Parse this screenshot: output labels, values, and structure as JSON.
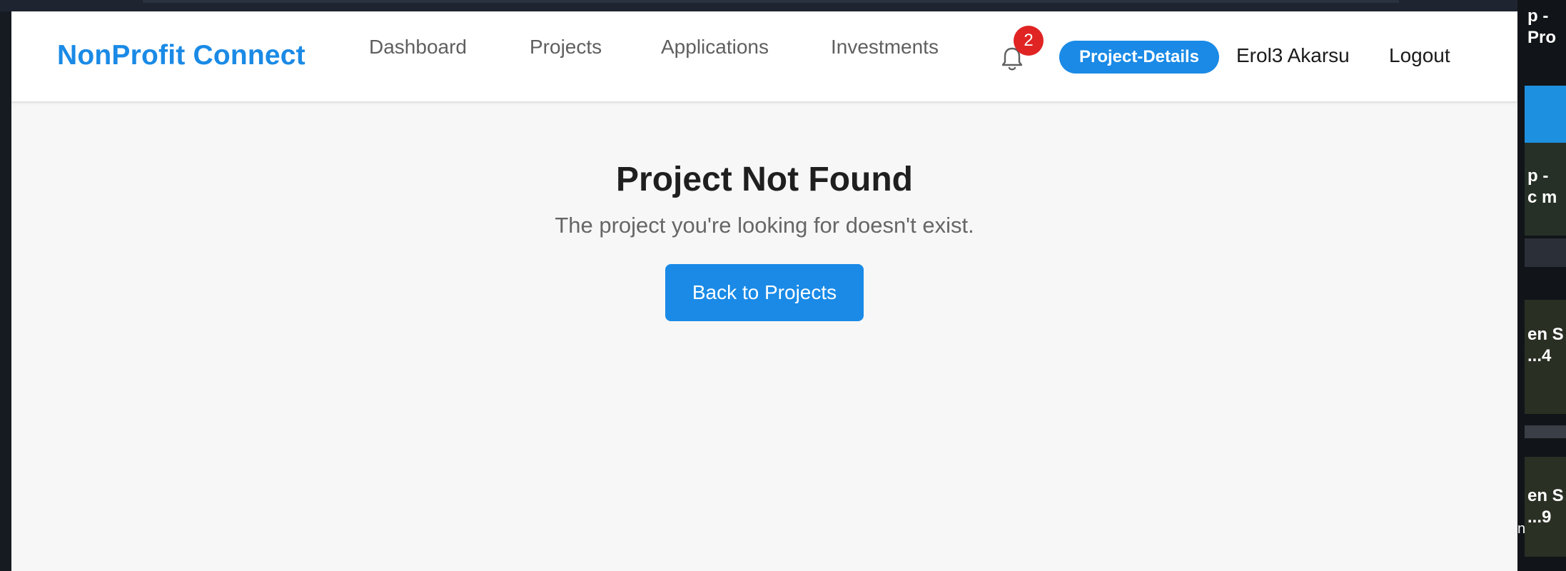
{
  "app": {
    "brand": "NonProfit Connect"
  },
  "nav": {
    "links": [
      {
        "label": "Dashboard"
      },
      {
        "label": "Projects"
      },
      {
        "label": "Applications"
      },
      {
        "label": "Investments"
      }
    ],
    "notifications": {
      "icon": "bell-icon",
      "count": "2"
    },
    "current_page": "Project-Details",
    "user_name": "Erol3 Akarsu",
    "logout_label": "Logout"
  },
  "content": {
    "title": "Project Not Found",
    "message": "The project you're looking for doesn't exist.",
    "back_button_label": "Back to Projects"
  },
  "background_window": {
    "snippets": [
      "p -",
      "Pro",
      "p -",
      "c m",
      "en S",
      "...4",
      "en S",
      "...9",
      "n"
    ]
  },
  "colors": {
    "accent": "#1a8ae6",
    "badge": "#e02424",
    "page_background": "#f7f7f7",
    "navbar_background": "#ffffff"
  }
}
